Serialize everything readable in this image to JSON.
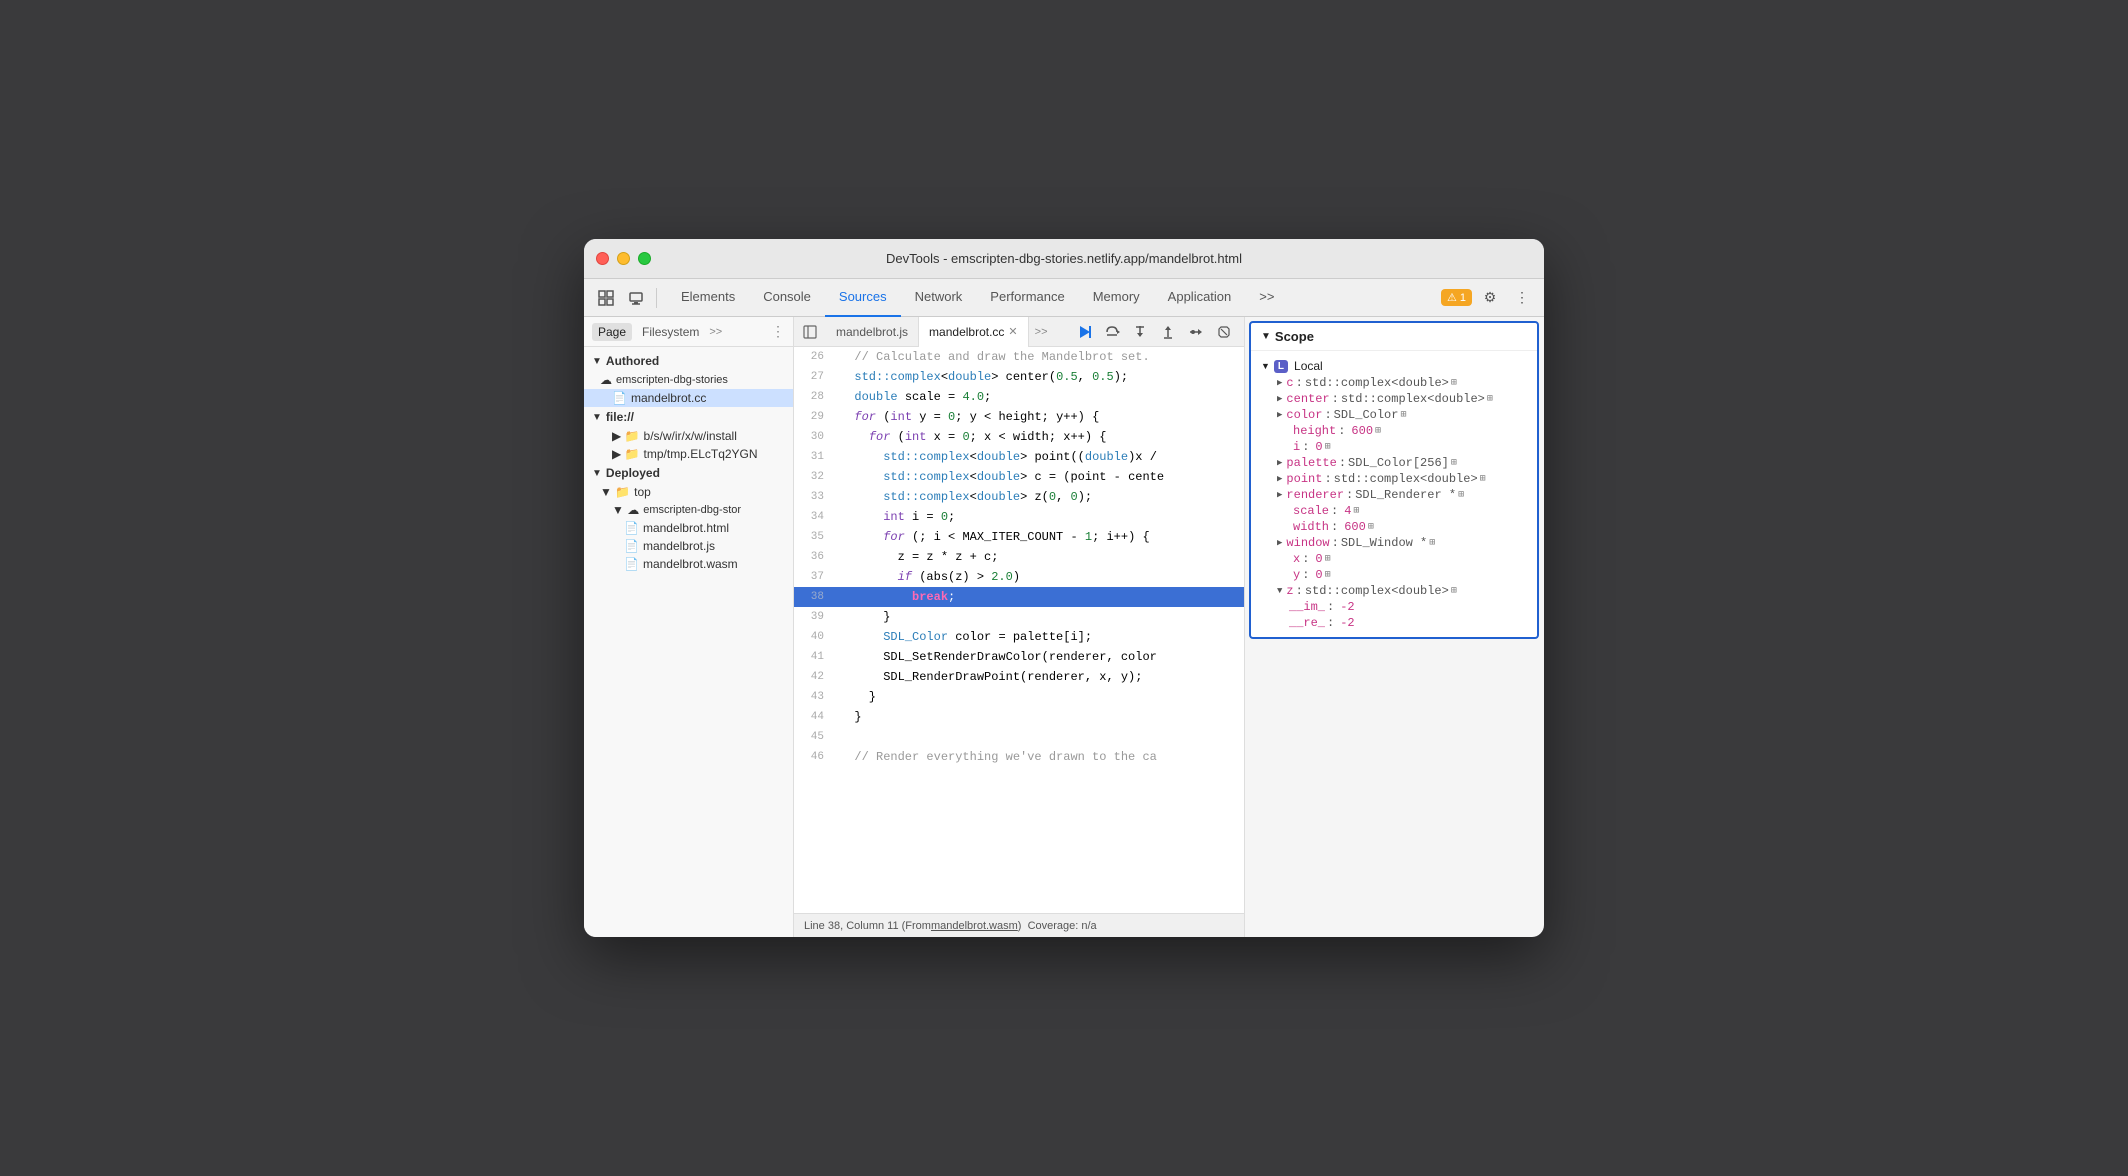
{
  "titlebar": {
    "title": "DevTools - emscripten-dbg-stories.netlify.app/mandelbrot.html"
  },
  "toolbar": {
    "tabs": [
      {
        "id": "elements",
        "label": "Elements",
        "active": false
      },
      {
        "id": "console",
        "label": "Console",
        "active": false
      },
      {
        "id": "sources",
        "label": "Sources",
        "active": true
      },
      {
        "id": "network",
        "label": "Network",
        "active": false
      },
      {
        "id": "performance",
        "label": "Performance",
        "active": false
      },
      {
        "id": "memory",
        "label": "Memory",
        "active": false
      },
      {
        "id": "application",
        "label": "Application",
        "active": false
      }
    ],
    "more_label": ">>",
    "warning_count": "1"
  },
  "left_panel": {
    "tabs": [
      "Page",
      "Filesystem",
      ">>"
    ],
    "tree": [
      {
        "indent": 0,
        "label": "Authored",
        "type": "section",
        "expanded": true
      },
      {
        "indent": 1,
        "label": "emscripten-dbg-stories",
        "type": "cloud-folder",
        "expanded": true
      },
      {
        "indent": 2,
        "label": "mandelbrot.cc",
        "type": "file-cc",
        "selected": true
      },
      {
        "indent": 1,
        "label": "file://",
        "type": "folder",
        "expanded": true
      },
      {
        "indent": 2,
        "label": "b/s/w/ir/x/w/install",
        "type": "folder"
      },
      {
        "indent": 2,
        "label": "tmp/tmp.ELcTq2YGN",
        "type": "folder"
      },
      {
        "indent": 0,
        "label": "Deployed",
        "type": "section",
        "expanded": true
      },
      {
        "indent": 1,
        "label": "top",
        "type": "folder",
        "expanded": true
      },
      {
        "indent": 2,
        "label": "emscripten-dbg-stor",
        "type": "cloud-folder",
        "expanded": true
      },
      {
        "indent": 3,
        "label": "mandelbrot.html",
        "type": "file-html"
      },
      {
        "indent": 3,
        "label": "mandelbrot.js",
        "type": "file-js"
      },
      {
        "indent": 3,
        "label": "mandelbrot.wasm",
        "type": "file-wasm"
      }
    ]
  },
  "code_panel": {
    "tabs": [
      "mandelbrot.js",
      "mandelbrot.cc"
    ],
    "active_tab": "mandelbrot.cc",
    "lines": [
      {
        "num": 26,
        "code": "  // Calculate and draw the Mandelbrot set."
      },
      {
        "num": 27,
        "code": "  std::complex<double> center(0.5, 0.5);"
      },
      {
        "num": 28,
        "code": "  double scale = 4.0;"
      },
      {
        "num": 29,
        "code": "  for (int y = 0; y < height; y++) {"
      },
      {
        "num": 30,
        "code": "    for (int x = 0; x < width; x++) {"
      },
      {
        "num": 31,
        "code": "      std::complex<double> point((double)x /"
      },
      {
        "num": 32,
        "code": "      std::complex<double> c = (point - cente"
      },
      {
        "num": 33,
        "code": "      std::complex<double> z(0, 0);"
      },
      {
        "num": 34,
        "code": "      int i = 0;"
      },
      {
        "num": 35,
        "code": "      for (; i < MAX_ITER_COUNT - 1; i++) {"
      },
      {
        "num": 36,
        "code": "        z = z * z + c;"
      },
      {
        "num": 37,
        "code": "        if (abs(z) > 2.0)"
      },
      {
        "num": 38,
        "code": "          break;",
        "highlighted": true
      },
      {
        "num": 39,
        "code": "      }"
      },
      {
        "num": 40,
        "code": "      SDL_Color color = palette[i];"
      },
      {
        "num": 41,
        "code": "      SDL_SetRenderDrawColor(renderer, color"
      },
      {
        "num": 42,
        "code": "      SDL_RenderDrawPoint(renderer, x, y);"
      },
      {
        "num": 43,
        "code": "    }"
      },
      {
        "num": 44,
        "code": "  }"
      },
      {
        "num": 45,
        "code": ""
      },
      {
        "num": 46,
        "code": "  // Render everything we've drawn to the ca"
      }
    ],
    "status": "Line 38, Column 11 (From mandelbrot.wasm)  Coverage: n/a"
  },
  "scope_panel": {
    "title": "Scope",
    "local_section": "Local",
    "vars": [
      {
        "name": "c",
        "type": "std::complex<double>",
        "expandable": true
      },
      {
        "name": "center",
        "type": "std::complex<double>",
        "expandable": true
      },
      {
        "name": "color",
        "type": "SDL_Color",
        "expandable": true
      },
      {
        "name": "height",
        "type": null,
        "val": "600"
      },
      {
        "name": "i",
        "type": null,
        "val": "0"
      },
      {
        "name": "palette",
        "type": "SDL_Color[256]",
        "expandable": true
      },
      {
        "name": "point",
        "type": "std::complex<double>",
        "expandable": true
      },
      {
        "name": "renderer",
        "type": "SDL_Renderer *",
        "expandable": true
      },
      {
        "name": "scale",
        "type": null,
        "val": "4"
      },
      {
        "name": "width",
        "type": null,
        "val": "600"
      },
      {
        "name": "window",
        "type": "SDL_Window *",
        "expandable": true
      },
      {
        "name": "x",
        "type": null,
        "val": "0"
      },
      {
        "name": "y",
        "type": null,
        "val": "0"
      },
      {
        "name": "z",
        "type": "std::complex<double>",
        "expandable": true,
        "expanded": true
      }
    ],
    "z_children": [
      {
        "name": "__im_",
        "val": "-2"
      },
      {
        "name": "__re_",
        "val": "-2"
      }
    ]
  },
  "debugger_controls": {
    "play": "▶",
    "step_over": "↺",
    "step_into": "↓",
    "step_out": "↑",
    "step": "→",
    "deactivate": "⊘"
  }
}
